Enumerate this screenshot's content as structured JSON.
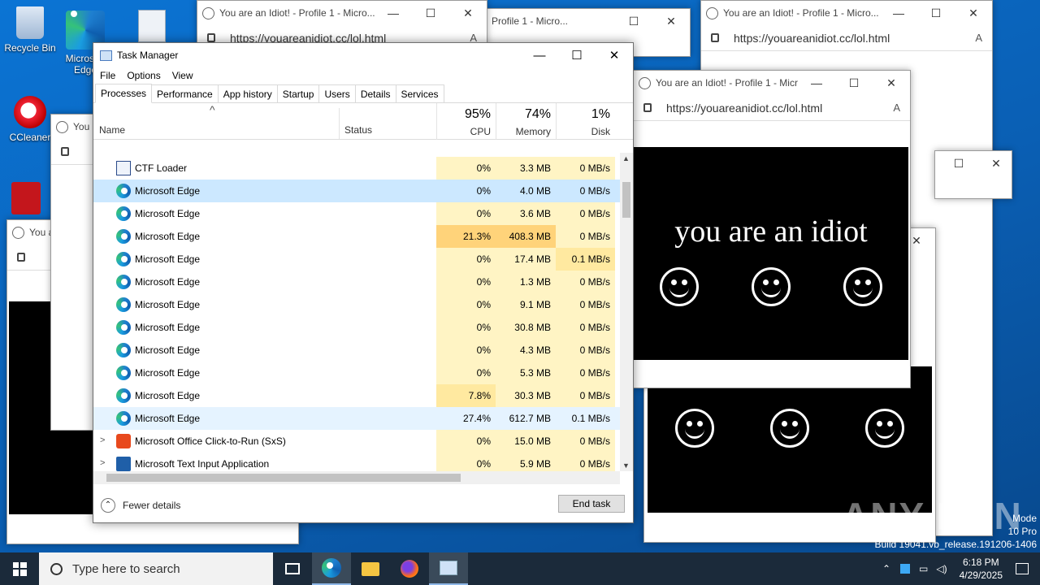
{
  "desktop": {
    "icons": [
      {
        "label": "Recycle Bin"
      },
      {
        "label": "Microsoft Edge"
      },
      {
        "label": "CCleaner"
      }
    ],
    "os_text": [
      "Mode",
      "10 Pro",
      "Build 19041.vb_release.191206-1406"
    ],
    "watermark": "ANY RUN"
  },
  "popup": {
    "title": "You are an Idiot! - Profile 1 - Micro...",
    "title_short": "Profile 1 - Micro...",
    "title_cut": "You a",
    "url": "https://youareanidiot.cc/lol.html",
    "message": "you are an idiot"
  },
  "taskmanager": {
    "title": "Task Manager",
    "menu": [
      "File",
      "Options",
      "View"
    ],
    "tabs": [
      "Processes",
      "Performance",
      "App history",
      "Startup",
      "Users",
      "Details",
      "Services"
    ],
    "active_tab": "Processes",
    "columns": {
      "name": "Name",
      "status": "Status",
      "cpu": {
        "pct": "95%",
        "label": "CPU"
      },
      "memory": {
        "pct": "74%",
        "label": "Memory"
      },
      "disk": {
        "pct": "1%",
        "label": "Disk"
      }
    },
    "rows": [
      {
        "name": "CTF Loader",
        "icon": "ctf-loader-icon",
        "cpu": "0%",
        "memory": "3.3 MB",
        "disk": "0 MB/s"
      },
      {
        "name": "Microsoft Edge",
        "icon": "edge-icon",
        "cpu": "0%",
        "memory": "4.0 MB",
        "disk": "0 MB/s",
        "selected": true
      },
      {
        "name": "Microsoft Edge",
        "icon": "edge-icon",
        "cpu": "0%",
        "memory": "3.6 MB",
        "disk": "0 MB/s"
      },
      {
        "name": "Microsoft Edge",
        "icon": "edge-icon",
        "cpu": "21.3%",
        "memory": "408.3 MB",
        "disk": "0 MB/s"
      },
      {
        "name": "Microsoft Edge",
        "icon": "edge-icon",
        "cpu": "0%",
        "memory": "17.4 MB",
        "disk": "0.1 MB/s"
      },
      {
        "name": "Microsoft Edge",
        "icon": "edge-icon",
        "cpu": "0%",
        "memory": "1.3 MB",
        "disk": "0 MB/s"
      },
      {
        "name": "Microsoft Edge",
        "icon": "edge-icon",
        "cpu": "0%",
        "memory": "9.1 MB",
        "disk": "0 MB/s"
      },
      {
        "name": "Microsoft Edge",
        "icon": "edge-icon",
        "cpu": "0%",
        "memory": "30.8 MB",
        "disk": "0 MB/s"
      },
      {
        "name": "Microsoft Edge",
        "icon": "edge-icon",
        "cpu": "0%",
        "memory": "4.3 MB",
        "disk": "0 MB/s"
      },
      {
        "name": "Microsoft Edge",
        "icon": "edge-icon",
        "cpu": "0%",
        "memory": "5.3 MB",
        "disk": "0 MB/s"
      },
      {
        "name": "Microsoft Edge",
        "icon": "edge-icon",
        "cpu": "7.8%",
        "memory": "30.3 MB",
        "disk": "0 MB/s"
      },
      {
        "name": "Microsoft Edge",
        "icon": "edge-icon",
        "cpu": "27.4%",
        "memory": "612.7 MB",
        "disk": "0.1 MB/s",
        "hover": true
      },
      {
        "name": "Microsoft Office Click-to-Run (SxS)",
        "icon": "office-icon",
        "cpu": "0%",
        "memory": "15.0 MB",
        "disk": "0 MB/s",
        "expandable": true
      },
      {
        "name": "Microsoft Text Input Application",
        "icon": "text-input-icon",
        "cpu": "0%",
        "memory": "5.9 MB",
        "disk": "0 MB/s",
        "expandable": true
      }
    ],
    "fewer_details": "Fewer details",
    "end_task": "End task"
  },
  "taskbar": {
    "search_placeholder": "Type here to search",
    "time": "6:18 PM",
    "date": "4/29/2025"
  },
  "colors": {
    "heat_low": "#fff4c4",
    "heat_mid": "#ffe9a0",
    "heat_high": "#ffd37a",
    "selected": "#cce8ff",
    "hover": "#e5f3ff"
  }
}
